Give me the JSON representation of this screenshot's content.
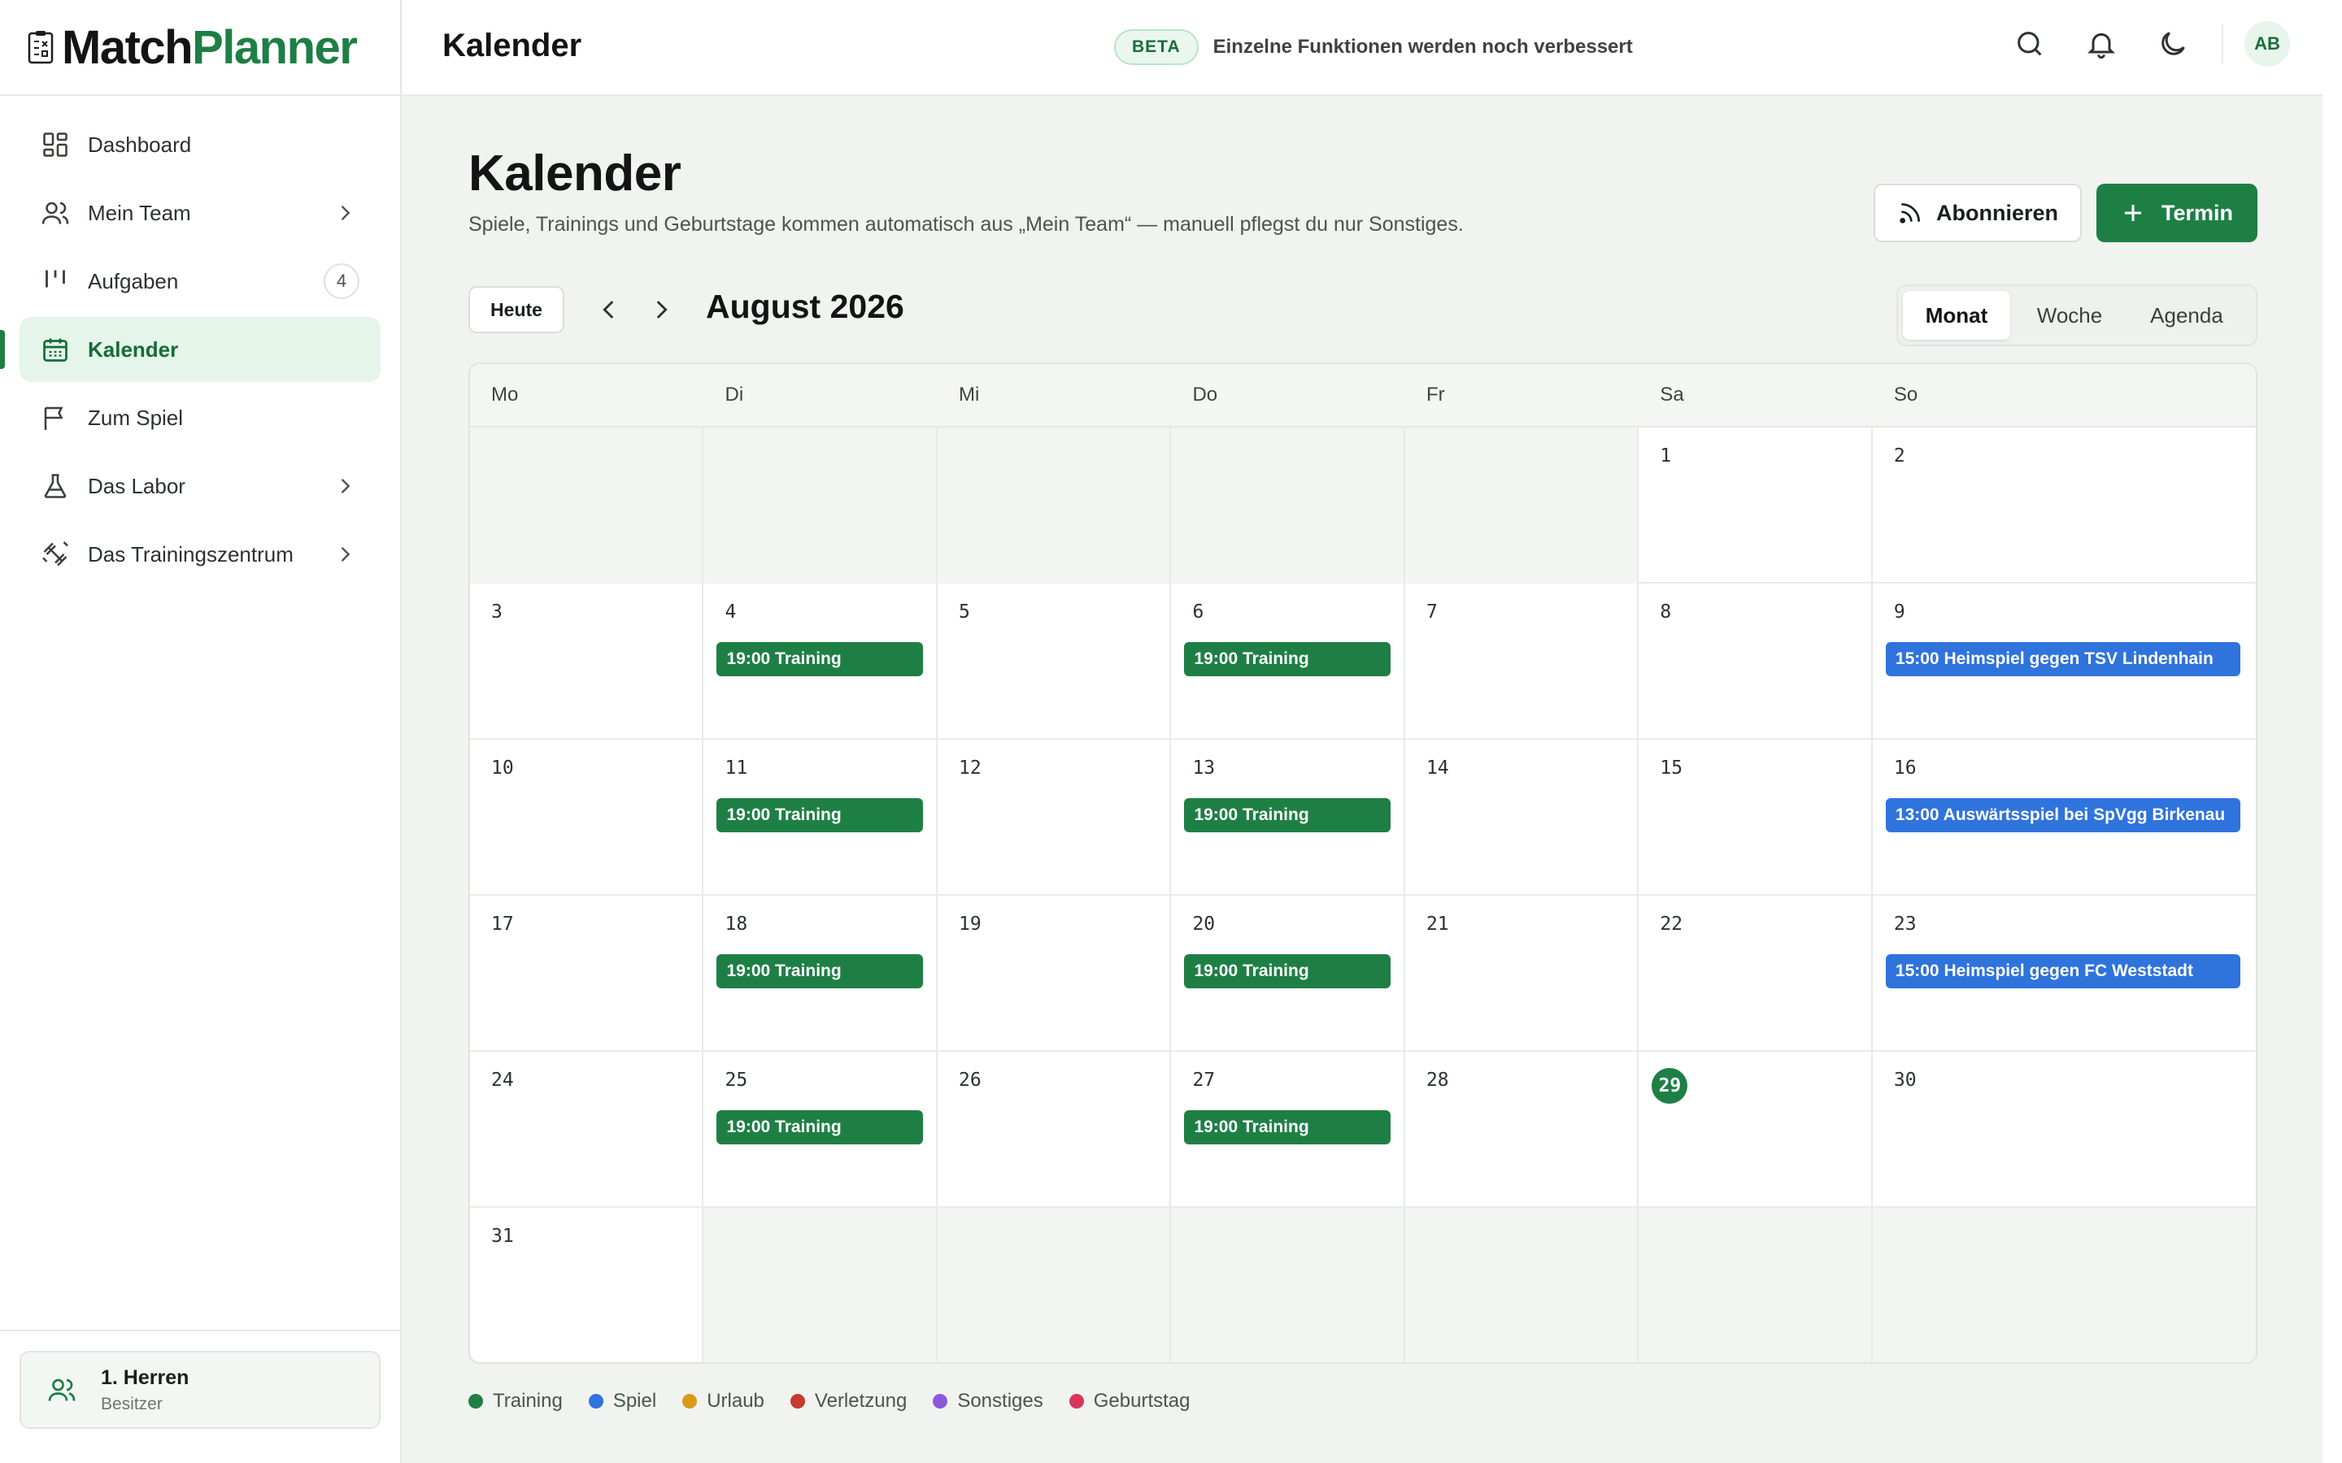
{
  "app": {
    "name_part1": "Match",
    "name_part2": "Planner"
  },
  "sidebar": {
    "items": [
      {
        "label": "Dashboard"
      },
      {
        "label": "Mein Team"
      },
      {
        "label": "Aufgaben",
        "badge": "4"
      },
      {
        "label": "Kalender"
      },
      {
        "label": "Zum Spiel"
      },
      {
        "label": "Das Labor"
      },
      {
        "label": "Das Trainingszentrum"
      }
    ],
    "team": {
      "name": "1. Herren",
      "role": "Besitzer"
    }
  },
  "topbar": {
    "title": "Kalender",
    "beta_label": "BETA",
    "beta_text": "Einzelne Funktionen werden noch verbessert",
    "avatar_initials": "AB"
  },
  "page": {
    "title": "Kalender",
    "subtitle": "Spiele, Trainings und Geburtstage kommen automatisch aus „Mein Team“ — manuell pflegst du nur Sonstiges.",
    "subscribe_label": "Abonnieren",
    "add_label": "Termin"
  },
  "toolbar": {
    "today_label": "Heute",
    "month_label": "August 2026",
    "views": [
      "Monat",
      "Woche",
      "Agenda"
    ],
    "active_view": "Monat"
  },
  "calendar": {
    "weekdays": [
      "Mo",
      "Di",
      "Mi",
      "Do",
      "Fr",
      "Sa",
      "So"
    ],
    "weeks": [
      [
        {
          "d": ""
        },
        {
          "d": ""
        },
        {
          "d": ""
        },
        {
          "d": ""
        },
        {
          "d": ""
        },
        {
          "d": "1"
        },
        {
          "d": "2"
        }
      ],
      [
        {
          "d": "3"
        },
        {
          "d": "4",
          "ev": "19:00 Training",
          "t": "training"
        },
        {
          "d": "5"
        },
        {
          "d": "6",
          "ev": "19:00 Training",
          "t": "training"
        },
        {
          "d": "7"
        },
        {
          "d": "8"
        },
        {
          "d": "9",
          "ev": "15:00 Heimspiel gegen TSV Lindenhain",
          "t": "spiel"
        }
      ],
      [
        {
          "d": "10"
        },
        {
          "d": "11",
          "ev": "19:00 Training",
          "t": "training"
        },
        {
          "d": "12"
        },
        {
          "d": "13",
          "ev": "19:00 Training",
          "t": "training"
        },
        {
          "d": "14"
        },
        {
          "d": "15"
        },
        {
          "d": "16",
          "ev": "13:00 Auswärtsspiel bei SpVgg Birkenau",
          "t": "spiel"
        }
      ],
      [
        {
          "d": "17"
        },
        {
          "d": "18",
          "ev": "19:00 Training",
          "t": "training"
        },
        {
          "d": "19"
        },
        {
          "d": "20",
          "ev": "19:00 Training",
          "t": "training"
        },
        {
          "d": "21"
        },
        {
          "d": "22"
        },
        {
          "d": "23",
          "ev": "15:00 Heimspiel gegen FC Weststadt",
          "t": "spiel"
        }
      ],
      [
        {
          "d": "24"
        },
        {
          "d": "25",
          "ev": "19:00 Training",
          "t": "training"
        },
        {
          "d": "26"
        },
        {
          "d": "27",
          "ev": "19:00 Training",
          "t": "training"
        },
        {
          "d": "28"
        },
        {
          "d": "29",
          "today": true
        },
        {
          "d": "30"
        }
      ],
      [
        {
          "d": "31"
        },
        {
          "d": ""
        },
        {
          "d": ""
        },
        {
          "d": ""
        },
        {
          "d": ""
        },
        {
          "d": ""
        },
        {
          "d": ""
        }
      ]
    ]
  },
  "legend": [
    {
      "label": "Training",
      "color": "#1e7f45"
    },
    {
      "label": "Spiel",
      "color": "#2f73dd"
    },
    {
      "label": "Urlaub",
      "color": "#d99a1c"
    },
    {
      "label": "Verletzung",
      "color": "#c93a2e"
    },
    {
      "label": "Sonstiges",
      "color": "#8a5ad8"
    },
    {
      "label": "Geburtstag",
      "color": "#d9365a"
    }
  ]
}
